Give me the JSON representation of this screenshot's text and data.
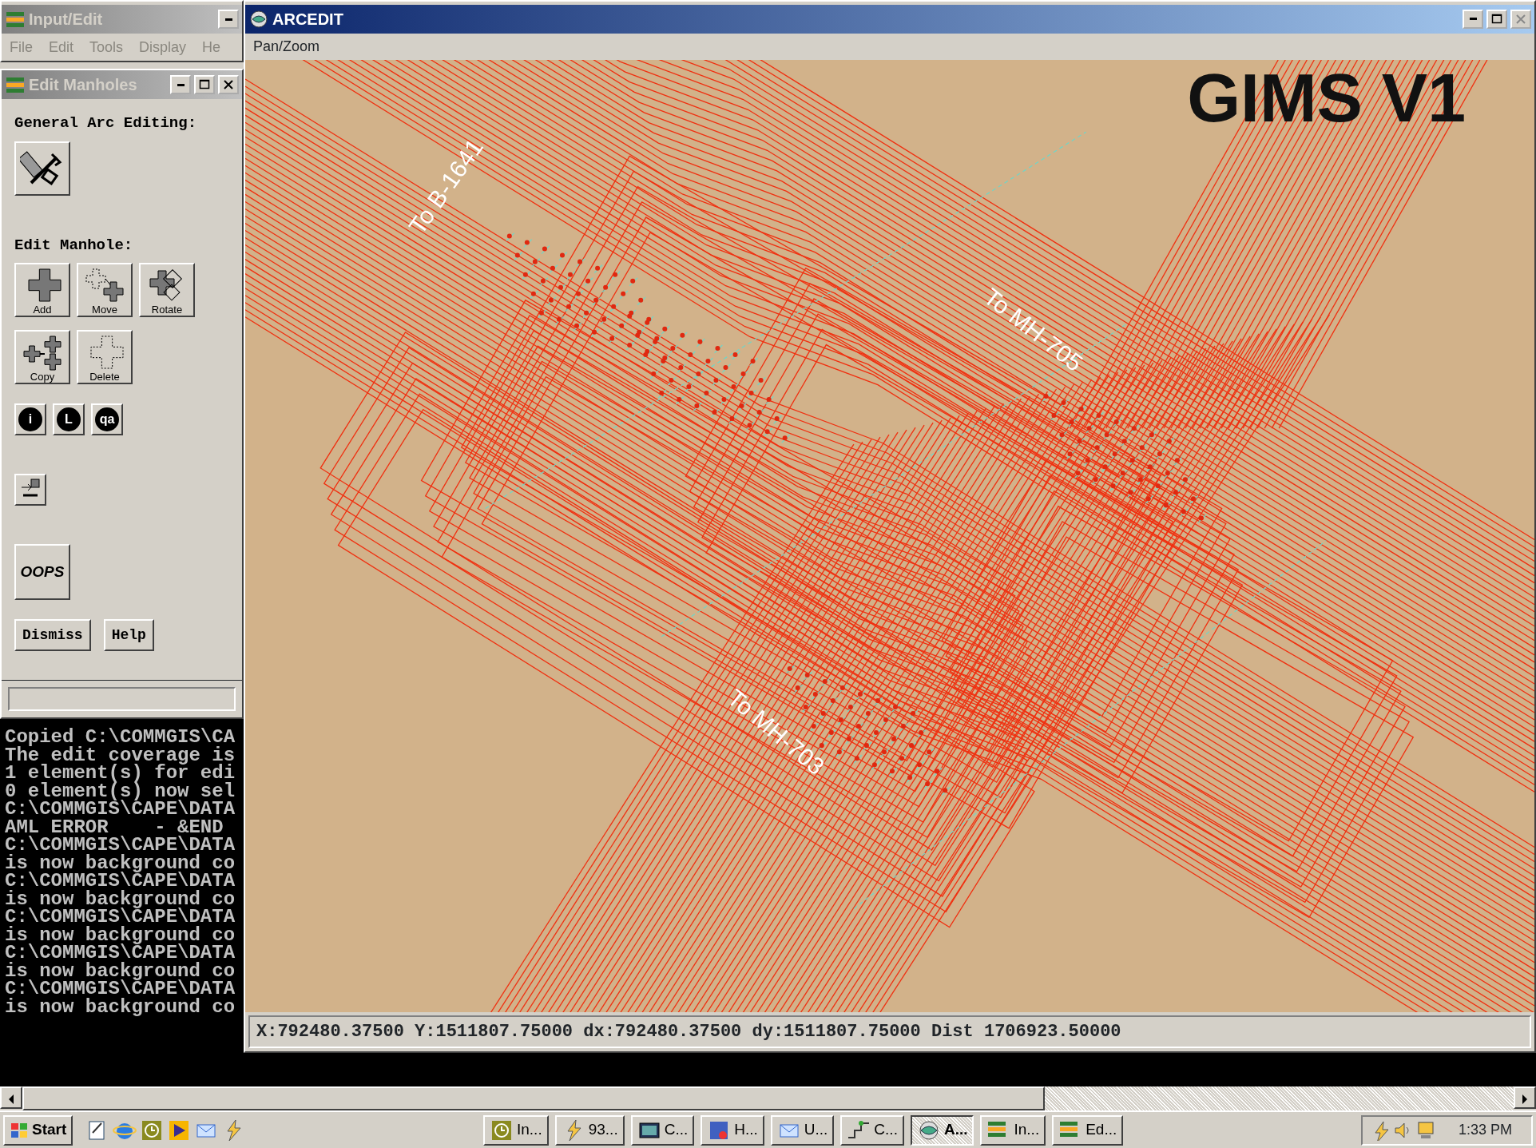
{
  "input_edit": {
    "title": "Input/Edit",
    "active": false,
    "menu": [
      {
        "label": "File",
        "disabled": true
      },
      {
        "label": "Edit",
        "disabled": true
      },
      {
        "label": "Tools",
        "disabled": true
      },
      {
        "label": "Display",
        "disabled": true
      },
      {
        "label": "He",
        "disabled": true
      }
    ]
  },
  "edit_manholes": {
    "title": "Edit Manholes",
    "active": false,
    "general_heading": "General Arc Editing:",
    "manhole_heading": "Edit Manhole:",
    "tools": [
      {
        "label": "Add",
        "kind": "add"
      },
      {
        "label": "Move",
        "kind": "move"
      },
      {
        "label": "Rotate",
        "kind": "rotate"
      },
      {
        "label": "Copy",
        "kind": "copy"
      },
      {
        "label": "Delete",
        "kind": "delete"
      }
    ],
    "info_buttons": [
      {
        "glyph": "i"
      },
      {
        "glyph": "L"
      },
      {
        "glyph": "qa"
      }
    ],
    "oops": "OOPS",
    "buttons": [
      "Dismiss",
      "Help"
    ]
  },
  "console": {
    "lines": [
      "Copied C:\\COMMGIS\\CA",
      "The edit coverage is",
      "1 element(s) for edi",
      "0 element(s) now sel",
      "C:\\COMMGIS\\CAPE\\DATA",
      "AML ERROR    - &END",
      "C:\\COMMGIS\\CAPE\\DATA",
      "is now background co",
      "C:\\COMMGIS\\CAPE\\DATA",
      "is now background co",
      "C:\\COMMGIS\\CAPE\\DATA",
      "is now background co",
      "C:\\COMMGIS\\CAPE\\DATA",
      "is now background co",
      "C:\\COMMGIS\\CAPE\\DATA",
      "is now background co"
    ]
  },
  "arcedit": {
    "title": "ARCEDIT",
    "active": true,
    "menu": [
      "Pan/Zoom"
    ],
    "map": {
      "overlay_title": "GIMS V1",
      "labels": [
        "To B-1641",
        "To MH-705",
        "To MH-703"
      ]
    },
    "status": "X:792480.37500 Y:1511807.75000 dx:792480.37500 dy:1511807.75000 Dist 1706923.50000"
  },
  "taskbar": {
    "start": "Start",
    "tasks": [
      {
        "label": "In...",
        "kind": "clock",
        "selected": false
      },
      {
        "label": "93...",
        "kind": "lightning",
        "selected": false
      },
      {
        "label": "C...",
        "kind": "console",
        "selected": false
      },
      {
        "label": "H...",
        "kind": "app",
        "selected": false
      },
      {
        "label": "U...",
        "kind": "mail",
        "selected": false
      },
      {
        "label": "C...",
        "kind": "steps",
        "selected": false
      },
      {
        "label": "A...",
        "kind": "globe",
        "selected": true
      },
      {
        "label": "In...",
        "kind": "layers",
        "selected": false
      },
      {
        "label": "Ed...",
        "kind": "layers",
        "selected": false
      }
    ],
    "clock": "1:33 PM"
  }
}
